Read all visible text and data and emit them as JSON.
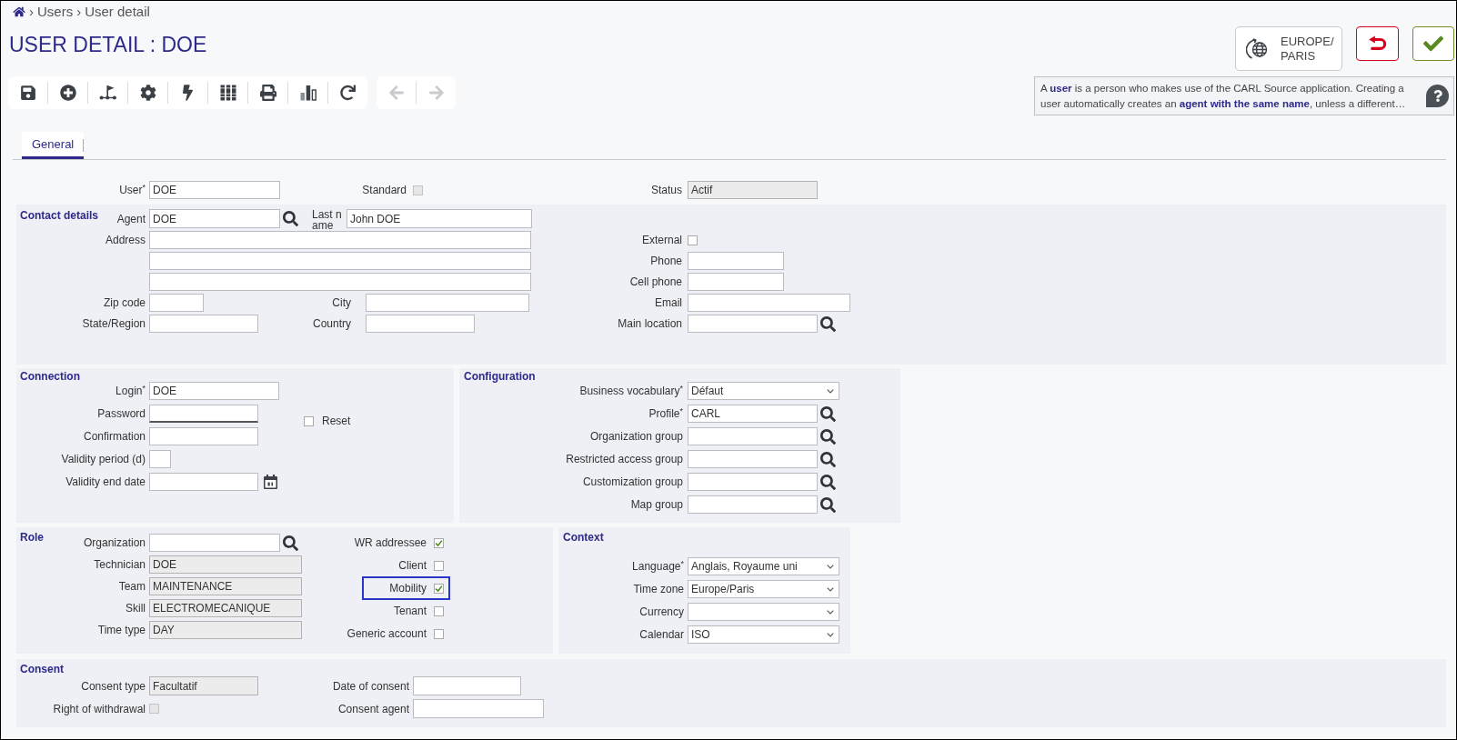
{
  "breadcrumb": [
    {
      "separator": "›",
      "label": "Users"
    },
    {
      "separator": "›",
      "label": "User detail"
    }
  ],
  "title": "USER DETAIL : DOE",
  "history_nav": [
    {
      "disabled": true
    },
    {
      "disabled": true
    }
  ],
  "timezone_button": {
    "label_lines": [
      "EUROPE/",
      "PARIS"
    ]
  },
  "info_text": "A **user** is a person who makes use of the CARL Source application. Creating a user automatically creates an **agent with the same name**, unless a different…",
  "tabs": [
    {
      "label": "General",
      "selected": true
    }
  ],
  "user_row": {
    "user": {
      "label": "User$^{*}$",
      "value": "DOE"
    },
    "standard": {
      "label": "Standard",
      "checked": false,
      "disabled": true
    },
    "status": {
      "label": "Status",
      "value": "Actif",
      "readonly": true
    }
  },
  "contact_details": {
    "title": "Contact details",
    "agent": {
      "label": "Agent",
      "value": "DOE"
    },
    "last_name": {
      "label": "Last name",
      "value": "John DOE"
    },
    "address": {
      "label": "Address"
    },
    "zip_code": {
      "label": "Zip code"
    },
    "city": {
      "label": "City"
    },
    "state_region": {
      "label": "State/Region"
    },
    "country": {
      "label": "Country"
    },
    "external": {
      "label": "External",
      "checked": false
    },
    "phone": {
      "label": "Phone"
    },
    "cell_phone": {
      "label": "Cell phone"
    },
    "email": {
      "label": "Email"
    },
    "main_location": {
      "label": "Main location"
    }
  },
  "connection": {
    "title": "Connection",
    "login": {
      "label": "Login$^{*}$",
      "value": "DOE"
    },
    "password": {
      "label": "Password",
      "focused": true
    },
    "reset": {
      "label": "Reset",
      "checked": false
    },
    "confirmation": {
      "label": "Confirmation"
    },
    "validity_period": {
      "label": "Validity period (d)"
    },
    "validity_end_date": {
      "label": "Validity end date"
    }
  },
  "configuration": {
    "title": "Configuration",
    "fields": [
      {
        "kind": "select",
        "label": "Business vocabulary$^{*}$",
        "value": "Défaut"
      },
      {
        "kind": "lookup",
        "label": "Profile$^{*}$",
        "value": "CARL"
      },
      {
        "kind": "lookup",
        "label": "Organization group"
      },
      {
        "kind": "lookup",
        "label": "Restricted access group"
      },
      {
        "kind": "lookup",
        "label": "Customization group"
      },
      {
        "kind": "lookup",
        "label": "Map group"
      }
    ]
  },
  "role": {
    "title": "Role",
    "fields": [
      {
        "kind": "lookup",
        "label": "Organization"
      },
      {
        "kind": "text",
        "label": "Technician",
        "value": "DOE",
        "readonly": true
      },
      {
        "kind": "text",
        "label": "Team",
        "value": "MAINTENANCE",
        "readonly": true
      },
      {
        "kind": "text",
        "label": "Skill",
        "value": "ELECTROMECANIQUE",
        "readonly": true
      },
      {
        "kind": "text",
        "label": "Time type",
        "value": "DAY",
        "readonly": true
      }
    ],
    "checks": [
      {
        "label": "WR addressee",
        "checked": true,
        "highlighted": false
      },
      {
        "label": "Client",
        "checked": false,
        "highlighted": false
      },
      {
        "label": "Mobility",
        "checked": true,
        "highlighted": true
      },
      {
        "label": "Tenant",
        "checked": false,
        "highlighted": false
      },
      {
        "label": "Generic account",
        "checked": false,
        "highlighted": false
      }
    ]
  },
  "context": {
    "title": "Context",
    "fields": [
      {
        "label": "Language$^{*}$",
        "value": "Anglais, Royaume uni"
      },
      {
        "label": "Time zone",
        "value": "Europe/Paris"
      },
      {
        "label": "Currency"
      },
      {
        "label": "Calendar",
        "value": "ISO"
      }
    ]
  },
  "consent": {
    "title": "Consent",
    "consent_type": {
      "label": "Consent type",
      "value": "Facultatif",
      "readonly": true
    },
    "right_of_withdrawal": {
      "label": "Right of withdrawal",
      "checked": false,
      "disabled": true
    },
    "date_of_consent": {
      "label": "Date of consent"
    },
    "consent_agent": {
      "label": "Consent agent"
    }
  }
}
